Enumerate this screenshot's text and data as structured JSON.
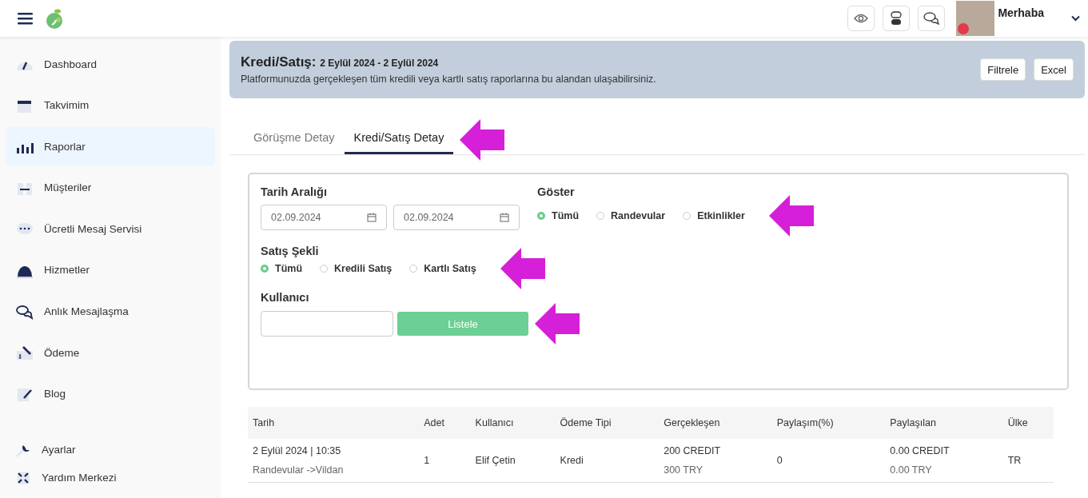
{
  "topbar": {
    "greeting": "Merhaba"
  },
  "sidebar": {
    "items": [
      {
        "label": "Dashboard",
        "selected": false
      },
      {
        "label": "Takvimim",
        "selected": false
      },
      {
        "label": "Raporlar",
        "selected": true
      },
      {
        "label": "Müşteriler",
        "selected": false
      },
      {
        "label": "Ücretli Mesaj Servisi",
        "selected": false
      },
      {
        "label": "Hizmetler",
        "selected": false
      },
      {
        "label": "Anlık Mesajlaşma",
        "selected": false
      },
      {
        "label": "Ödeme",
        "selected": false
      },
      {
        "label": "Blog",
        "selected": false
      }
    ],
    "bottom_items": [
      "Ayarlar",
      "Yardım Merkezi"
    ]
  },
  "banner": {
    "title": "Kredi/Satış:",
    "range": "2 Eylül 2024 - 2 Eylül 2024",
    "description": "Platformunuzda gerçekleşen tüm kredili veya kartlı satış raporlarına bu alandan ulaşabilirsiniz.",
    "buttons": [
      "Filtrele",
      "Excel"
    ]
  },
  "tabs": [
    {
      "label": "Görüşme Detay",
      "selected": false,
      "pointer_arrow": false
    },
    {
      "label": "Kredi/Satış Detay",
      "selected": true,
      "pointer_arrow": true
    }
  ],
  "filters": {
    "date_label": "Tarih Aralığı",
    "start_date": "02.09.2024",
    "end_date": "02.09.2024",
    "show": {
      "label": "Göster",
      "pointer_arrow": true,
      "options": [
        {
          "label": "Tümü",
          "selected": true
        },
        {
          "label": "Randevular",
          "selected": false
        },
        {
          "label": "Etkinlikler",
          "selected": false
        }
      ]
    },
    "sale_type": {
      "label": "Satış Şekli",
      "pointer_arrow": true,
      "options": [
        {
          "label": "Tümü",
          "selected": true
        },
        {
          "label": "Kredili Satış",
          "selected": false
        },
        {
          "label": "Kartlı Satış",
          "selected": false
        }
      ]
    },
    "user_label": "Kullanıcı",
    "list_button": "Listele",
    "list_button_pointer_arrow": true
  },
  "table": {
    "columns": [
      "Tarih",
      "Adet",
      "Kullanıcı",
      "Ödeme Tipi",
      "Gerçekleşen",
      "Paylaşım(%)",
      "Paylaşılan",
      "Ülke"
    ],
    "rows": [
      {
        "date": "2 Eylül 2024 | 10:35",
        "detail": "Randevular ->Vildan",
        "count": "1",
        "user": "Elif Çetin",
        "payment_type": "Kredi",
        "realized": [
          "200 CREDIT",
          "300 TRY"
        ],
        "share": "0",
        "shared": [
          "0.00 CREDIT",
          "0.00 TRY"
        ],
        "country": "TR"
      }
    ]
  }
}
